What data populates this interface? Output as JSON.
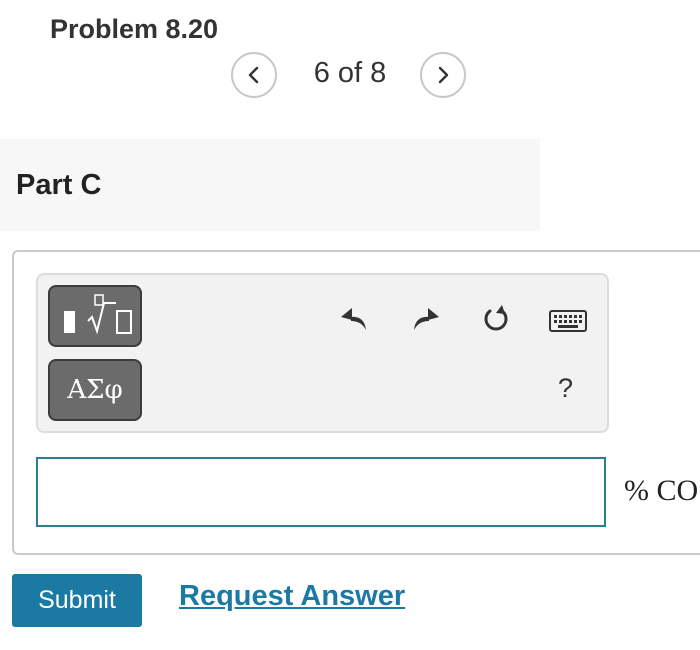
{
  "header": {
    "problem_title": "Problem 8.20",
    "pager": {
      "text": "6 of 8",
      "prev_icon": "chevron-left-icon",
      "next_icon": "chevron-right-icon"
    }
  },
  "part": {
    "title": "Part C"
  },
  "toolbar": {
    "template_button_icon": "fraction-root-template-icon",
    "greek_button_label": "ΑΣφ",
    "undo_icon": "undo-icon",
    "redo_icon": "redo-icon",
    "reset_icon": "reset-icon",
    "keyboard_icon": "keyboard-icon",
    "help_label": "?"
  },
  "answer": {
    "value": "",
    "unit_label": "% CO"
  },
  "actions": {
    "submit_label": "Submit",
    "request_answer_label": "Request Answer"
  },
  "colors": {
    "accent": "#1a7aa3",
    "input_border": "#2a7f8f",
    "template_button": "#6b6b6b"
  }
}
